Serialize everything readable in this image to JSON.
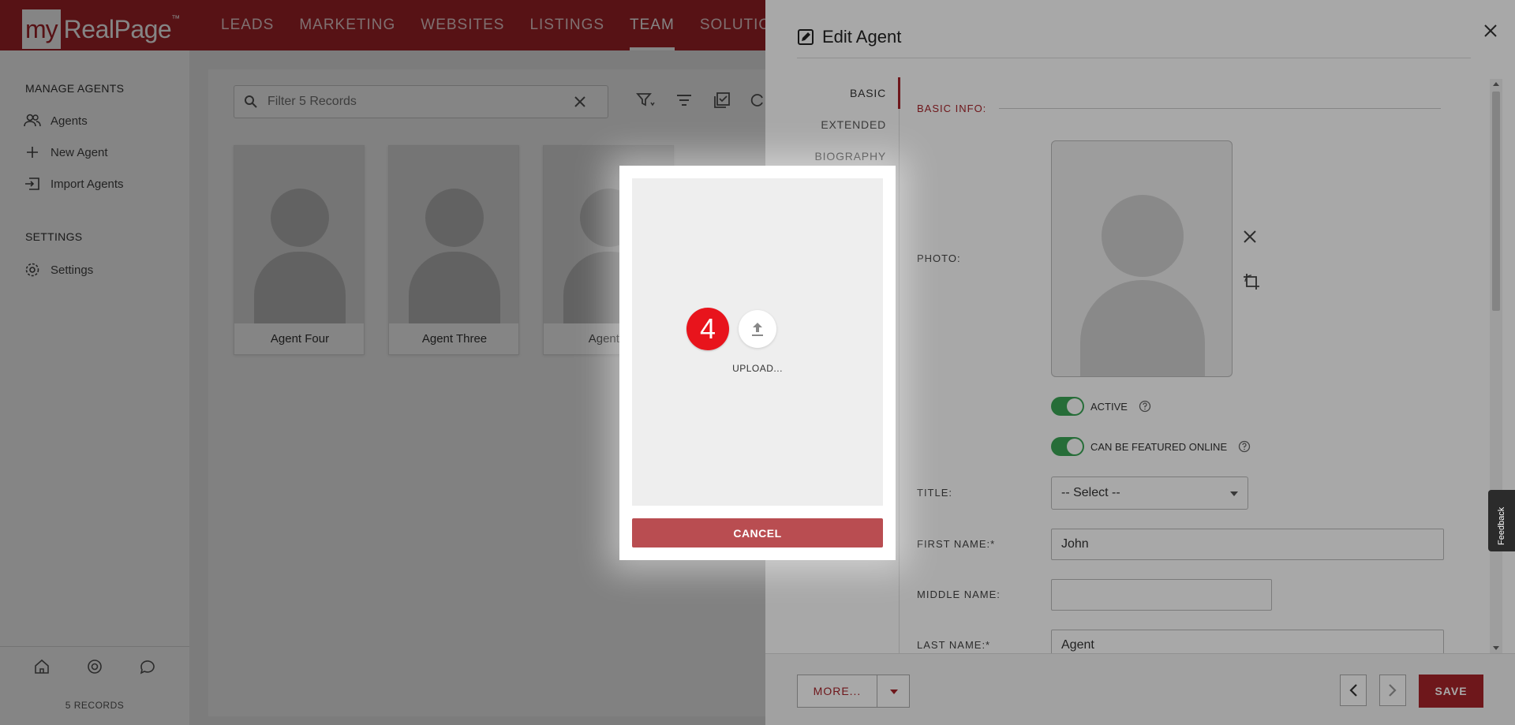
{
  "app": {
    "logo_my": "my",
    "logo_rest": "RealPage",
    "logo_tm": "™",
    "nav": [
      "LEADS",
      "MARKETING",
      "WEBSITES",
      "LISTINGS",
      "TEAM",
      "SOLUTIONS"
    ],
    "active_nav": "TEAM",
    "brand_color": "#a8232a"
  },
  "sidebar": {
    "manage_heading": "MANAGE AGENTS",
    "items": [
      {
        "label": "Agents",
        "icon": "people-icon"
      },
      {
        "label": "New Agent",
        "icon": "plus-icon"
      },
      {
        "label": "Import Agents",
        "icon": "import-icon"
      }
    ],
    "settings_heading": "SETTINGS",
    "settings_item": {
      "label": "Settings",
      "icon": "gear-icon"
    },
    "footer_icons": [
      "home-icon",
      "support-icon",
      "chat-icon"
    ],
    "records": "5 RECORDS"
  },
  "main": {
    "search_placeholder": "Filter 5 Records",
    "cards": [
      {
        "name": "Agent Four"
      },
      {
        "name": "Agent Three"
      },
      {
        "name": "Agent F"
      }
    ]
  },
  "panel": {
    "title": "Edit Agent",
    "tabs": [
      "BASIC",
      "EXTENDED",
      "BIOGRAPHY"
    ],
    "active_tab": "BASIC",
    "section": "BASIC INFO:",
    "photo_label": "PHOTO:",
    "active_label": "ACTIVE",
    "featured_label": "CAN BE FEATURED ONLINE",
    "title_label": "TITLE:",
    "title_select": "-- Select --",
    "first_name_label": "FIRST NAME:*",
    "first_name": "John",
    "middle_name_label": "MIDDLE NAME:",
    "middle_name": "",
    "last_name_label": "LAST NAME:*",
    "last_name": "Agent",
    "more_label": "MORE...",
    "save_label": "SAVE",
    "feedback_label": "Feedback"
  },
  "dialog": {
    "step_number": "4",
    "upload_text": "UPLOAD...",
    "cancel_label": "CANCEL"
  }
}
